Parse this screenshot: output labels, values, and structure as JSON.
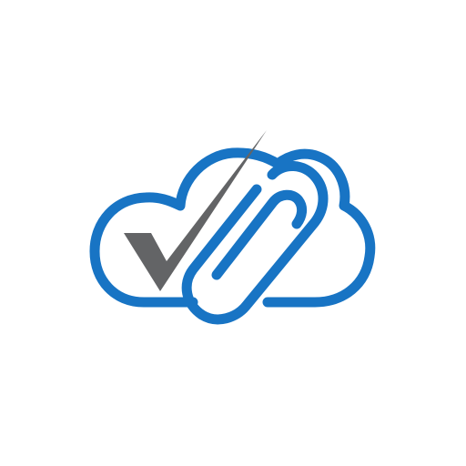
{
  "logo": {
    "icon": "cloud-checkmark-paperclip-icon",
    "colors": {
      "cloud_outline": "#1874c4",
      "checkmark": "#636466",
      "paperclip": "#1874c4",
      "background": "#ffffff"
    }
  }
}
